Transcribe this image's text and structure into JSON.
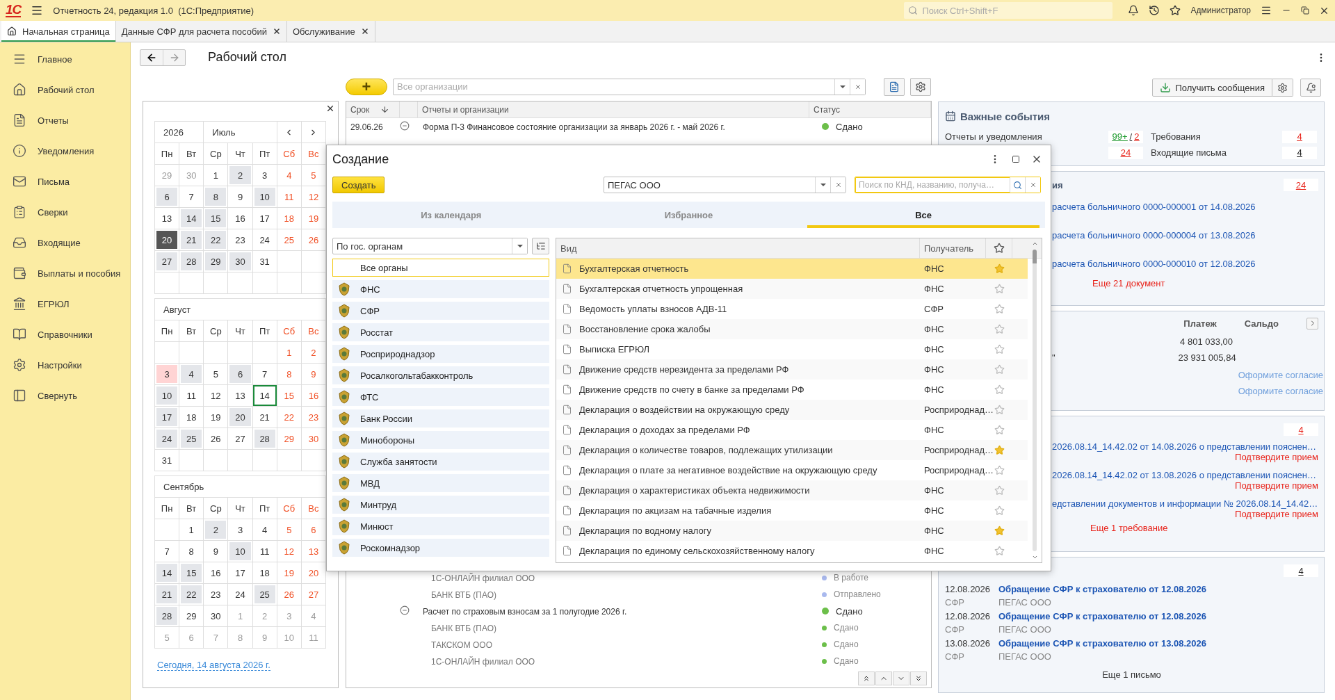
{
  "title_bar": {
    "logo": "1С",
    "title": "Отчетность 24, редакция 1.0  (1С:Предприятие)",
    "search": {
      "placeholder": "Поиск Ctrl+Shift+F"
    },
    "user": "Администратор"
  },
  "tabs": [
    {
      "label": "Начальная страница",
      "selected": true,
      "closable": false
    },
    {
      "label": "Данные СФР для расчета пособий",
      "selected": false,
      "closable": true
    },
    {
      "label": "Обслуживание",
      "selected": false,
      "closable": true
    }
  ],
  "sidebar": {
    "items": [
      {
        "label": "Главное"
      },
      {
        "label": "Рабочий стол"
      },
      {
        "label": "Отчеты"
      },
      {
        "label": "Уведомления"
      },
      {
        "label": "Письма"
      },
      {
        "label": "Сверки"
      },
      {
        "label": "Входящие"
      },
      {
        "label": "Выплаты и пособия"
      },
      {
        "label": "ЕГРЮЛ"
      },
      {
        "label": "Справочники"
      },
      {
        "label": "Настройки"
      },
      {
        "label": "Свернуть"
      }
    ]
  },
  "page": {
    "title": "Рабочий стол"
  },
  "calendar": {
    "year": "2026",
    "month": "Июль",
    "today_link": "Сегодня, 14 августа 2026 г.",
    "months": [
      {
        "weekdays": [
          {
            "label": "Пн",
            "weekend": false
          },
          {
            "label": "Вт",
            "weekend": false
          },
          {
            "label": "Ср",
            "weekend": false
          },
          {
            "label": "Чт",
            "weekend": false
          },
          {
            "label": "Пт",
            "weekend": false
          },
          {
            "label": "Сб",
            "weekend": true
          },
          {
            "label": "Вс",
            "weekend": true
          }
        ],
        "weeks": [
          {
            "days": [
              {
                "d": "29",
                "kind": "other"
              },
              {
                "d": "30",
                "kind": "other"
              },
              {
                "d": "1",
                "kind": "plain"
              },
              {
                "d": "2",
                "kind": "marked"
              },
              {
                "d": "3",
                "kind": "plain"
              },
              {
                "d": "4",
                "kind": "weekend"
              },
              {
                "d": "5",
                "kind": "weekend"
              }
            ]
          },
          {
            "days": [
              {
                "d": "6",
                "kind": "marked"
              },
              {
                "d": "7",
                "kind": "plain"
              },
              {
                "d": "8",
                "kind": "marked"
              },
              {
                "d": "9",
                "kind": "plain"
              },
              {
                "d": "10",
                "kind": "marked"
              },
              {
                "d": "11",
                "kind": "weekend"
              },
              {
                "d": "12",
                "kind": "weekend"
              }
            ]
          },
          {
            "days": [
              {
                "d": "13",
                "kind": "plain"
              },
              {
                "d": "14",
                "kind": "marked"
              },
              {
                "d": "15",
                "kind": "marked"
              },
              {
                "d": "16",
                "kind": "plain"
              },
              {
                "d": "17",
                "kind": "plain"
              },
              {
                "d": "18",
                "kind": "weekend"
              },
              {
                "d": "19",
                "kind": "weekend"
              }
            ]
          },
          {
            "days": [
              {
                "d": "20",
                "kind": "current"
              },
              {
                "d": "21",
                "kind": "marked"
              },
              {
                "d": "22",
                "kind": "marked"
              },
              {
                "d": "23",
                "kind": "plain"
              },
              {
                "d": "24",
                "kind": "plain"
              },
              {
                "d": "25",
                "kind": "weekend"
              },
              {
                "d": "26",
                "kind": "weekend"
              }
            ]
          },
          {
            "days": [
              {
                "d": "27",
                "kind": "marked"
              },
              {
                "d": "28",
                "kind": "marked"
              },
              {
                "d": "29",
                "kind": "marked"
              },
              {
                "d": "30",
                "kind": "marked"
              },
              {
                "d": "31",
                "kind": "plain"
              }
            ]
          }
        ]
      },
      {
        "title": "Август",
        "weekdays": [
          {
            "label": "Пн",
            "weekend": false
          },
          {
            "label": "Вт",
            "weekend": false
          },
          {
            "label": "Ср",
            "weekend": false
          },
          {
            "label": "Чт",
            "weekend": false
          },
          {
            "label": "Пт",
            "weekend": false
          },
          {
            "label": "Сб",
            "weekend": true
          },
          {
            "label": "Вс",
            "weekend": true
          }
        ],
        "weeks": [
          {
            "kind": "tail",
            "days": [
              {
                "d": "1",
                "kind": "weekend"
              },
              {
                "d": "2",
                "kind": "weekend"
              }
            ]
          },
          {
            "days": [
              {
                "d": "3",
                "kind": "alert"
              },
              {
                "d": "4",
                "kind": "marked"
              },
              {
                "d": "5",
                "kind": "plain"
              },
              {
                "d": "6",
                "kind": "marked"
              },
              {
                "d": "7",
                "kind": "plain"
              },
              {
                "d": "8",
                "kind": "weekend"
              },
              {
                "d": "9",
                "kind": "weekend"
              }
            ]
          },
          {
            "days": [
              {
                "d": "10",
                "kind": "marked"
              },
              {
                "d": "11",
                "kind": "plain"
              },
              {
                "d": "12",
                "kind": "plain"
              },
              {
                "d": "13",
                "kind": "plain"
              },
              {
                "d": "14",
                "kind": "today"
              },
              {
                "d": "15",
                "kind": "weekend"
              },
              {
                "d": "16",
                "kind": "weekend"
              }
            ]
          },
          {
            "days": [
              {
                "d": "17",
                "kind": "marked"
              },
              {
                "d": "18",
                "kind": "plain"
              },
              {
                "d": "19",
                "kind": "plain"
              },
              {
                "d": "20",
                "kind": "marked"
              },
              {
                "d": "21",
                "kind": "plain"
              },
              {
                "d": "22",
                "kind": "weekend"
              },
              {
                "d": "23",
                "kind": "weekend"
              }
            ]
          },
          {
            "days": [
              {
                "d": "24",
                "kind": "marked"
              },
              {
                "d": "25",
                "kind": "marked"
              },
              {
                "d": "26",
                "kind": "plain"
              },
              {
                "d": "27",
                "kind": "plain"
              },
              {
                "d": "28",
                "kind": "marked"
              },
              {
                "d": "29",
                "kind": "weekend"
              },
              {
                "d": "30",
                "kind": "weekend"
              }
            ]
          },
          {
            "days": [
              {
                "d": "31",
                "kind": "plain"
              }
            ]
          }
        ]
      },
      {
        "title": "Сентябрь",
        "weekdays": [
          {
            "label": "Пн",
            "weekend": false
          },
          {
            "label": "Вт",
            "weekend": false
          },
          {
            "label": "Ср",
            "weekend": false
          },
          {
            "label": "Чт",
            "weekend": false
          },
          {
            "label": "Пт",
            "weekend": false
          },
          {
            "label": "Сб",
            "weekend": true
          },
          {
            "label": "Вс",
            "weekend": true
          }
        ],
        "weeks": [
          {
            "kind": "tail",
            "days": [
              {
                "d": "1",
                "kind": "plain"
              },
              {
                "d": "2",
                "kind": "marked"
              },
              {
                "d": "3",
                "kind": "plain"
              },
              {
                "d": "4",
                "kind": "plain"
              },
              {
                "d": "5",
                "kind": "weekend"
              },
              {
                "d": "6",
                "kind": "weekend"
              }
            ]
          },
          {
            "days": [
              {
                "d": "7",
                "kind": "plain"
              },
              {
                "d": "8",
                "kind": "plain"
              },
              {
                "d": "9",
                "kind": "plain"
              },
              {
                "d": "10",
                "kind": "marked"
              },
              {
                "d": "11",
                "kind": "plain"
              },
              {
                "d": "12",
                "kind": "weekend"
              },
              {
                "d": "13",
                "kind": "weekend"
              }
            ]
          },
          {
            "days": [
              {
                "d": "14",
                "kind": "marked"
              },
              {
                "d": "15",
                "kind": "marked"
              },
              {
                "d": "16",
                "kind": "plain"
              },
              {
                "d": "17",
                "kind": "plain"
              },
              {
                "d": "18",
                "kind": "plain"
              },
              {
                "d": "19",
                "kind": "weekend"
              },
              {
                "d": "20",
                "kind": "weekend"
              }
            ]
          },
          {
            "days": [
              {
                "d": "21",
                "kind": "marked"
              },
              {
                "d": "22",
                "kind": "marked"
              },
              {
                "d": "23",
                "kind": "plain"
              },
              {
                "d": "24",
                "kind": "plain"
              },
              {
                "d": "25",
                "kind": "marked"
              },
              {
                "d": "26",
                "kind": "weekend"
              },
              {
                "d": "27",
                "kind": "weekend"
              }
            ]
          },
          {
            "days": [
              {
                "d": "28",
                "kind": "marked"
              },
              {
                "d": "29",
                "kind": "plain"
              },
              {
                "d": "30",
                "kind": "plain"
              },
              {
                "d": "1",
                "kind": "other"
              },
              {
                "d": "2",
                "kind": "other"
              },
              {
                "d": "3",
                "kind": "other"
              },
              {
                "d": "4",
                "kind": "other"
              }
            ]
          },
          {
            "days": [
              {
                "d": "5",
                "kind": "other"
              },
              {
                "d": "6",
                "kind": "other"
              },
              {
                "d": "7",
                "kind": "other"
              },
              {
                "d": "8",
                "kind": "other"
              },
              {
                "d": "9",
                "kind": "other"
              },
              {
                "d": "10",
                "kind": "other"
              },
              {
                "d": "11",
                "kind": "other"
              }
            ]
          }
        ]
      }
    ]
  },
  "reports": {
    "add_button": "+",
    "org_filter": {
      "placeholder": "Все организации"
    },
    "columns": {
      "due": "Срок",
      "name": "Отчеты и организации",
      "status": "Статус"
    },
    "row_groups": [
      [
        {
          "kind": "report",
          "date": "29.06.26",
          "expanded": true,
          "name": "Форма П-3 Финансовое состояние организации за январь 2026 г. - май 2026 г.",
          "status": "Сдано",
          "color": "#6cbf4a"
        }
      ],
      [
        {
          "kind": "org",
          "name": "1С-ОНЛАЙН филиал ООО",
          "status": "В работе",
          "color": "#a9b9ee"
        },
        {
          "kind": "org",
          "name": "БАНК ВТБ (ПАО)",
          "status": "Отправлено",
          "color": "#a9b9ee"
        },
        {
          "kind": "report",
          "expanded": true,
          "name": "Расчет по страховым взносам за 1 полугодие 2026 г.",
          "status": "Сдано",
          "color": "#6cbf4a"
        },
        {
          "kind": "org",
          "name": "БАНК ВТБ (ПАО)",
          "status": "Сдано",
          "color": "#6cbf4a"
        },
        {
          "kind": "org",
          "name": "ТАКСКОМ ООО",
          "status": "Сдано",
          "color": "#6cbf4a"
        },
        {
          "kind": "org",
          "name": "1С-ОНЛАЙН филиал ООО",
          "status": "Сдано",
          "color": "#6cbf4a"
        }
      ]
    ]
  },
  "events": {
    "get_button": "Получить сообщения",
    "summary": {
      "title": "Важные события",
      "items": [
        {
          "label": "Отчеты и уведомления",
          "separator": "/",
          "counts": [
            {
              "text": "99+",
              "color": "#1e9a2e"
            },
            {
              "text": "2",
              "color": "#e8231a"
            }
          ]
        },
        {
          "label": "Требования",
          "counts": [
            {
              "text": "4",
              "color": "#e8231a"
            }
          ]
        },
        {
          "counts": [
            {
              "text": "24",
              "color": "#e8231a"
            }
          ]
        },
        {
          "label": "Входящие письма",
          "counts": [
            {
              "text": "4",
              "color": "#222222"
            }
          ]
        }
      ]
    },
    "documents": {
      "title": "ия",
      "count": "24",
      "links": [
        "расчета больничного 0000-000001 от 14.08.2026",
        "расчета больничного 0000-000004 от 13.08.2026",
        "расчета больничного 0000-000010 от 12.08.2026"
      ],
      "more": "Еще 21 документ"
    },
    "payments": {
      "columns": [
        "Платеж",
        "Сальдо"
      ],
      "rows": [
        {
          "payment": "4 801 033,00"
        },
        {
          "fragment": "\"",
          "payment": "23 931 005,84"
        },
        {
          "action": "Оформите согласие"
        },
        {
          "action": "Оформите согласие"
        }
      ]
    },
    "requirements": {
      "count": "4",
      "items": [
        {
          "link": "2026.08.14_14.42.02 от 14.08.2026 о представлении пояснен…",
          "action": "Подтвердите прием"
        },
        {
          "link": "2026.08.14_14.42.02 от 13.08.2026 о представлении пояснен…",
          "action": "Подтвердите прием"
        },
        {
          "link": "едставлении документов и информации № 2026.08.14_14.42…",
          "action": "Подтвердите прием"
        }
      ],
      "more": "Еще 1 требование"
    },
    "letters": {
      "count": "4",
      "items": [
        {
          "date": "12.08.2026",
          "sender": "СФР",
          "subject": "Обращение СФР к страхователю от 12.08.2026",
          "org": "ПЕГАС ООО"
        },
        {
          "date": "12.08.2026",
          "sender": "СФР",
          "subject": "Обращение СФР к страхователю от 12.08.2026",
          "org": "ПЕГАС ООО"
        },
        {
          "date": "13.08.2026",
          "sender": "СФР",
          "subject": "Обращение СФР к страхователю от 13.08.2026",
          "org": "ПЕГАС ООО"
        }
      ],
      "more": "Еще 1 письмо"
    }
  },
  "dialog": {
    "title": "Создание",
    "create_button": "Создать",
    "org_field": {
      "value": "ПЕГАС ООО"
    },
    "search": {
      "placeholder": "Поиск по КНД, названию, получа…"
    },
    "tabs": [
      {
        "label": "Из календаря",
        "selected": false
      },
      {
        "label": "Избранное",
        "selected": false
      },
      {
        "label": "Все",
        "selected": true
      }
    ],
    "grouping": {
      "value": "По гос. органам"
    },
    "bodies": [
      {
        "label": "Все органы",
        "kind": "all",
        "selected": true
      },
      {
        "label": "ФНС",
        "kind": "body",
        "selected": false
      },
      {
        "label": "СФР",
        "kind": "body",
        "selected": false
      },
      {
        "label": "Росстат",
        "kind": "body",
        "selected": false
      },
      {
        "label": "Росприроднадзор",
        "kind": "body",
        "selected": false
      },
      {
        "label": "Росалкогольтабакконтроль",
        "kind": "body",
        "selected": false
      },
      {
        "label": "ФТС",
        "kind": "body",
        "selected": false
      },
      {
        "label": "Банк России",
        "kind": "body",
        "selected": false
      },
      {
        "label": "Минобороны",
        "kind": "body",
        "selected": false
      },
      {
        "label": "Служба занятости",
        "kind": "body",
        "selected": false
      },
      {
        "label": "МВД",
        "kind": "body",
        "selected": false
      },
      {
        "label": "Минтруд",
        "kind": "body",
        "selected": false
      },
      {
        "label": "Минюст",
        "kind": "body",
        "selected": false
      },
      {
        "label": "Роскомнадзор",
        "kind": "body",
        "selected": false
      }
    ],
    "table": {
      "columns": {
        "kind": "Вид",
        "recipient": "Получатель"
      },
      "rows": [
        {
          "name": "Бухгалтерская отчетность",
          "recipient": "ФНС",
          "favorite": true,
          "selected": true
        },
        {
          "name": "Бухгалтерская отчетность упрощенная",
          "recipient": "ФНС",
          "favorite": false,
          "selected": false
        },
        {
          "name": "Ведомость уплаты взносов АДВ-11",
          "recipient": "СФР",
          "favorite": false,
          "selected": false
        },
        {
          "name": "Восстановление срока жалобы",
          "recipient": "ФНС",
          "favorite": false,
          "selected": false
        },
        {
          "name": "Выписка ЕГРЮЛ",
          "recipient": "ФНС",
          "favorite": false,
          "selected": false
        },
        {
          "name": "Движение средств нерезидента за пределами РФ",
          "recipient": "ФНС",
          "favorite": false,
          "selected": false
        },
        {
          "name": "Движение средств по счету в банке за пределами РФ",
          "recipient": "ФНС",
          "favorite": false,
          "selected": false
        },
        {
          "name": "Декларация о воздействии на окружающую среду",
          "recipient": "Росприроднад…",
          "favorite": false,
          "selected": false
        },
        {
          "name": "Декларация о доходах за пределами РФ",
          "recipient": "ФНС",
          "favorite": false,
          "selected": false
        },
        {
          "name": "Декларация о количестве товаров, подлежащих утилизации",
          "recipient": "Росприроднад…",
          "favorite": true,
          "selected": false
        },
        {
          "name": "Декларация о плате за негативное воздействие на окружающую среду",
          "recipient": "Росприроднад…",
          "favorite": false,
          "selected": false
        },
        {
          "name": "Декларация о характеристиках объекта недвижимости",
          "recipient": "ФНС",
          "favorite": false,
          "selected": false
        },
        {
          "name": "Декларация по акцизам на табачные изделия",
          "recipient": "ФНС",
          "favorite": false,
          "selected": false
        },
        {
          "name": "Декларация по водному налогу",
          "recipient": "ФНС",
          "favorite": true,
          "selected": false
        },
        {
          "name": "Декларация по единому сельскохозяйственному налогу",
          "recipient": "ФНС",
          "favorite": false,
          "selected": false
        }
      ]
    }
  }
}
